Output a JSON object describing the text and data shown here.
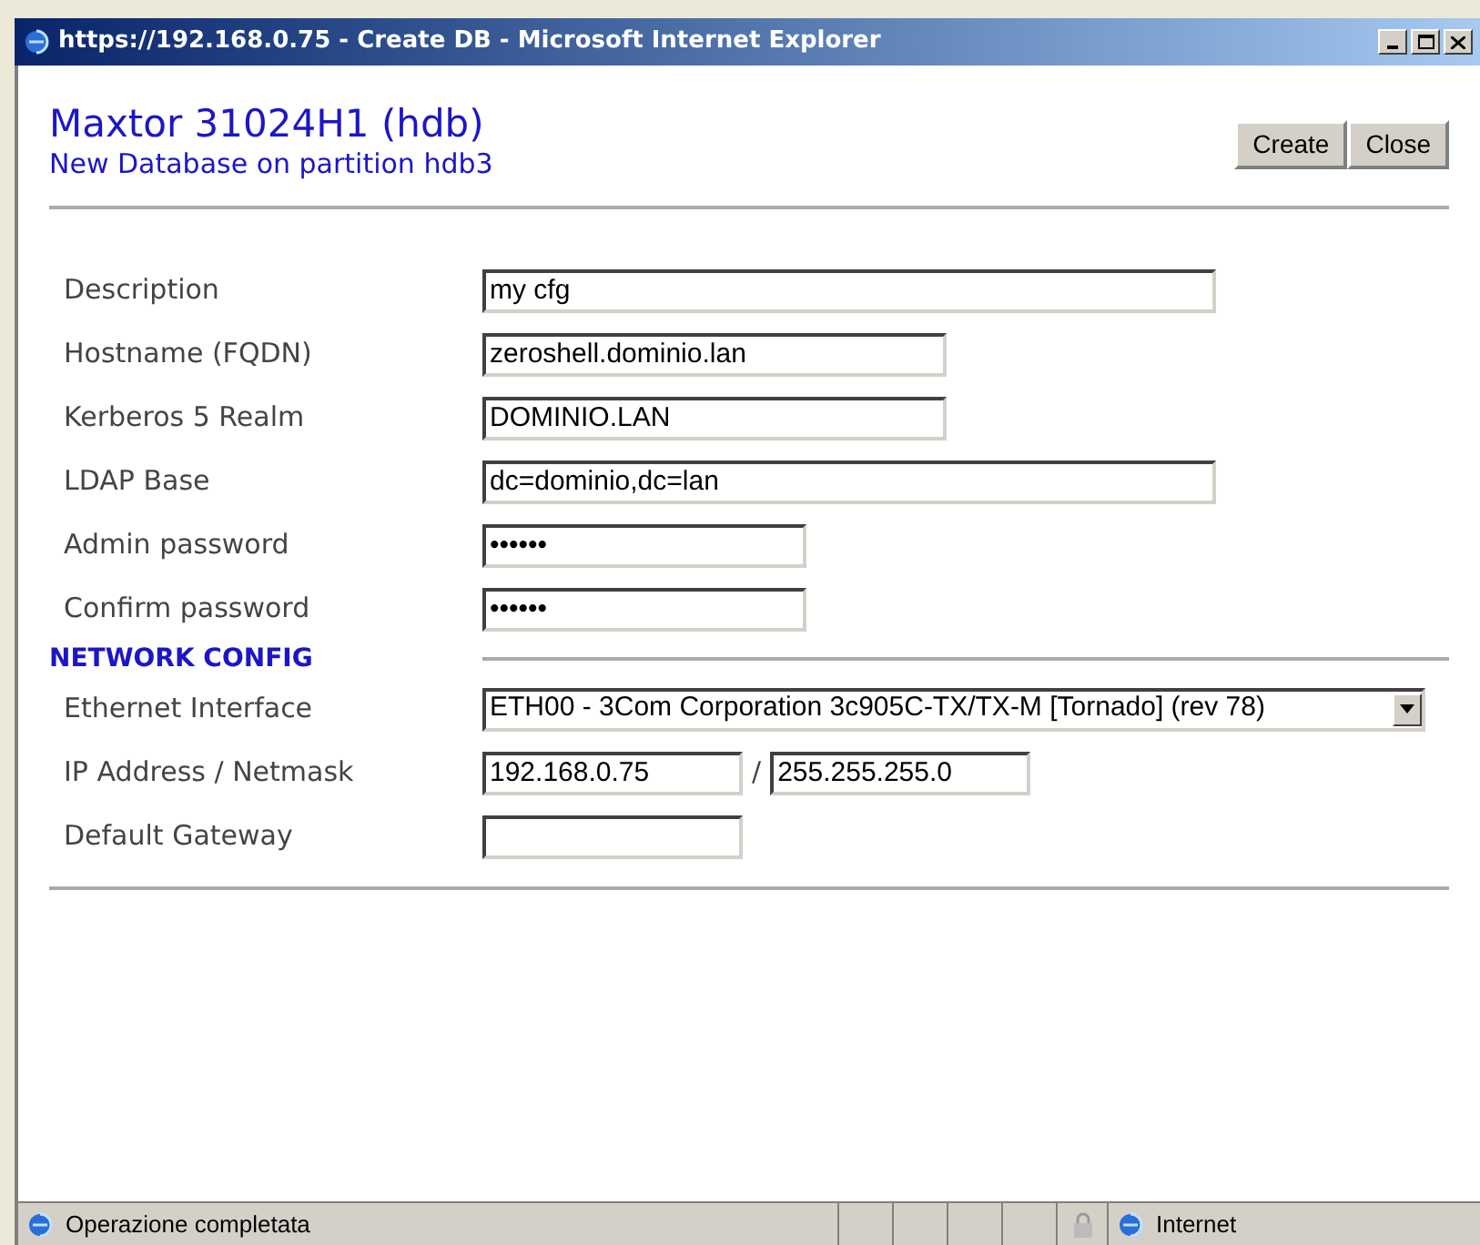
{
  "window": {
    "title": "https://192.168.0.75 - Create DB - Microsoft Internet Explorer"
  },
  "header": {
    "title": "Maxtor 31024H1 (hdb)",
    "subtitle": "New Database on partition hdb3"
  },
  "buttons": [
    "Create",
    "Close"
  ],
  "fields": [
    {
      "label": "Description",
      "value": "my cfg"
    },
    {
      "label": "Hostname (FQDN)",
      "value": "zeroshell.dominio.lan"
    },
    {
      "label": "Kerberos 5 Realm",
      "value": "DOMINIO.LAN"
    },
    {
      "label": "LDAP Base",
      "value": "dc=dominio,dc=lan"
    },
    {
      "label": "Admin password",
      "value": "••••••"
    },
    {
      "label": "Confirm password",
      "value": "••••••"
    }
  ],
  "network_section": {
    "title": "NETWORK CONFIG",
    "ethernet_interface": {
      "label": "Ethernet Interface",
      "value": "ETH00 - 3Com Corporation 3c905C-TX/TX-M [Tornado] (rev 78)"
    },
    "ip_netmask": {
      "label": "IP Address / Netmask",
      "ip": "192.168.0.75",
      "separator": "/",
      "netmask": "255.255.255.0"
    },
    "default_gateway": {
      "label": "Default Gateway"
    }
  },
  "status_bar": {
    "message": "Operazione completata",
    "zone": "Internet"
  }
}
